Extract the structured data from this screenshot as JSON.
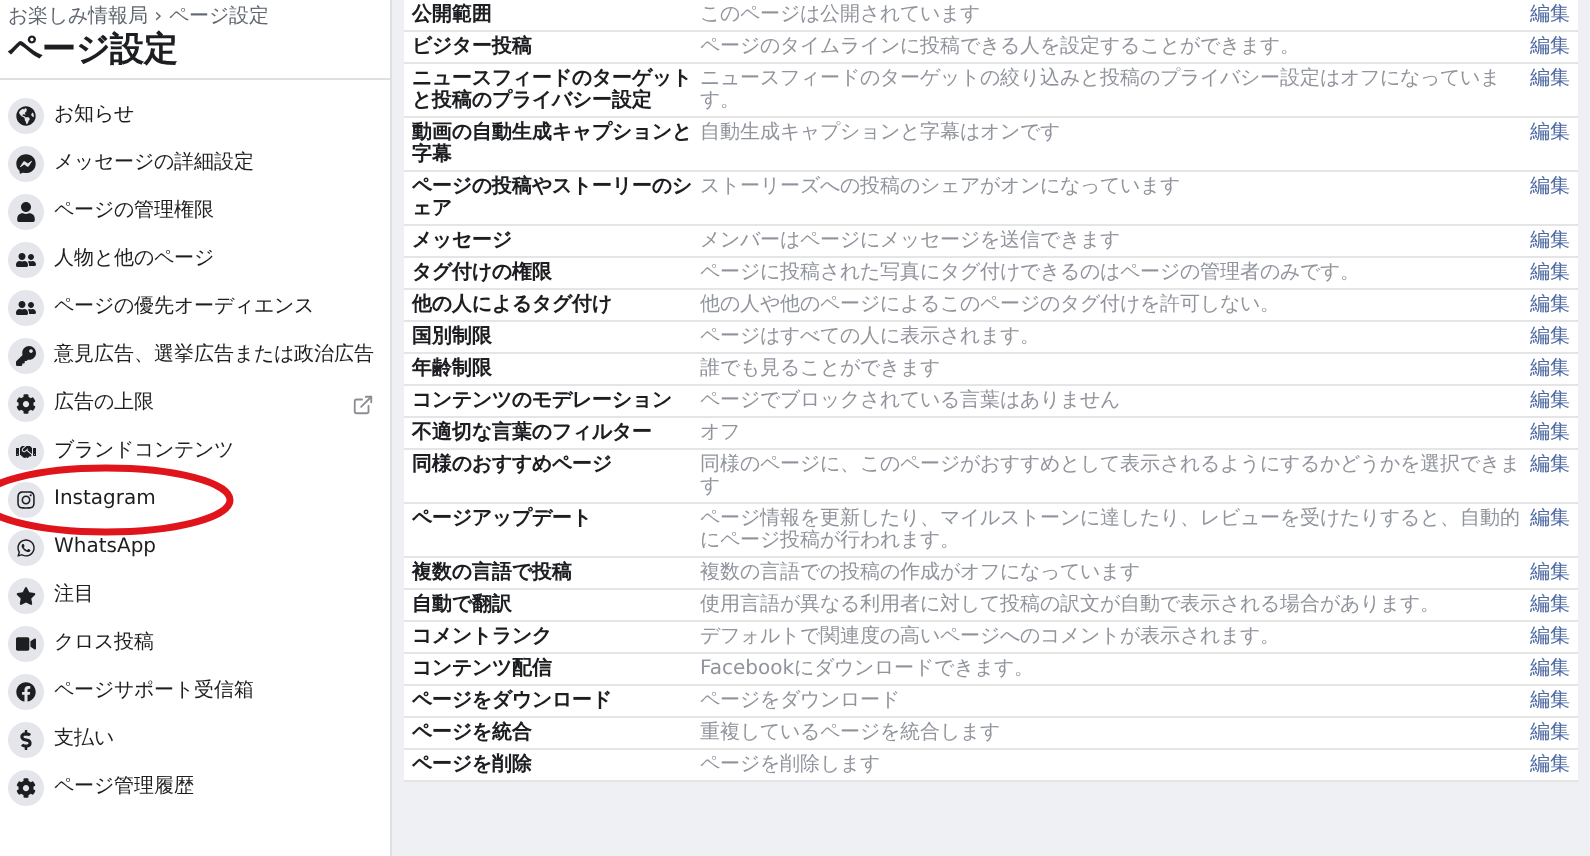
{
  "sidebar": {
    "breadcrumb": "お楽しみ情報局 › ページ設定",
    "title": "ページ設定",
    "items": [
      {
        "label": "お知らせ",
        "external": false,
        "circled": false
      },
      {
        "label": "メッセージの詳細設定",
        "external": false,
        "circled": false
      },
      {
        "label": "ページの管理権限",
        "external": false,
        "circled": false
      },
      {
        "label": "人物と他のページ",
        "external": false,
        "circled": false
      },
      {
        "label": "ページの優先オーディエンス",
        "external": false,
        "circled": false
      },
      {
        "label": "意見広告、選挙広告または政治広告",
        "external": false,
        "circled": false
      },
      {
        "label": "広告の上限",
        "external": true,
        "circled": false
      },
      {
        "label": "ブランドコンテンツ",
        "external": false,
        "circled": false
      },
      {
        "label": "Instagram",
        "external": false,
        "circled": true
      },
      {
        "label": "WhatsApp",
        "external": false,
        "circled": false
      },
      {
        "label": "注目",
        "external": false,
        "circled": false
      },
      {
        "label": "クロス投稿",
        "external": false,
        "circled": false
      },
      {
        "label": "ページサポート受信箱",
        "external": false,
        "circled": false
      },
      {
        "label": "支払い",
        "external": false,
        "circled": false
      },
      {
        "label": "ページ管理履歴",
        "external": false,
        "circled": false
      }
    ]
  },
  "settings": {
    "rows": [
      {
        "name": "公開範囲",
        "value": "このページは公開されています",
        "action": "編集"
      },
      {
        "name": "ビジター投稿",
        "value": "ページのタイムラインに投稿できる人を設定することができます。",
        "action": "編集"
      },
      {
        "name": "ニュースフィードのターゲットと投稿のプライバシー設定",
        "value": "ニュースフィードのターゲットの絞り込みと投稿のプライバシー設定はオフになっています。",
        "action": "編集"
      },
      {
        "name": "動画の自動生成キャプションと字幕",
        "value": "自動生成キャプションと字幕はオンです",
        "action": "編集"
      },
      {
        "name": "ページの投稿やストーリーのシェア",
        "value": "ストーリーズへの投稿のシェアがオンになっています",
        "action": "編集"
      },
      {
        "name": "メッセージ",
        "value": "メンバーはページにメッセージを送信できます",
        "action": "編集"
      },
      {
        "name": "タグ付けの権限",
        "value": "ページに投稿された写真にタグ付けできるのはページの管理者のみです。",
        "action": "編集"
      },
      {
        "name": "他の人によるタグ付け",
        "value": "他の人や他のページによるこのページのタグ付けを許可しない。",
        "action": "編集"
      },
      {
        "name": "国別制限",
        "value": "ページはすべての人に表示されます。",
        "action": "編集"
      },
      {
        "name": "年齢制限",
        "value": "誰でも見ることができます",
        "action": "編集"
      },
      {
        "name": "コンテンツのモデレーション",
        "value": "ページでブロックされている言葉はありません",
        "action": "編集"
      },
      {
        "name": "不適切な言葉のフィルター",
        "value": "オフ",
        "action": "編集"
      },
      {
        "name": "同様のおすすめページ",
        "value": "同様のページに、このページがおすすめとして表示されるようにするかどうかを選択できます",
        "action": "編集"
      },
      {
        "name": "ページアップデート",
        "value": "ページ情報を更新したり、マイルストーンに達したり、レビューを受けたりすると、自動的にページ投稿が行われます。",
        "action": "編集"
      },
      {
        "name": "複数の言語で投稿",
        "value": "複数の言語での投稿の作成がオフになっています",
        "action": "編集"
      },
      {
        "name": "自動で翻訳",
        "value": "使用言語が異なる利用者に対して投稿の訳文が自動で表示される場合があります。",
        "action": "編集"
      },
      {
        "name": "コメントランク",
        "value": "デフォルトで関連度の高いページへのコメントが表示されます。",
        "action": "編集"
      },
      {
        "name": "コンテンツ配信",
        "value": "Facebookにダウンロードできます。",
        "action": "編集"
      },
      {
        "name": "ページをダウンロード",
        "value": "ページをダウンロード",
        "action": "編集"
      },
      {
        "name": "ページを統合",
        "value": "重複しているページを統合します",
        "action": "編集"
      },
      {
        "name": "ページを削除",
        "value": "ページを削除します",
        "action": "編集"
      }
    ]
  }
}
